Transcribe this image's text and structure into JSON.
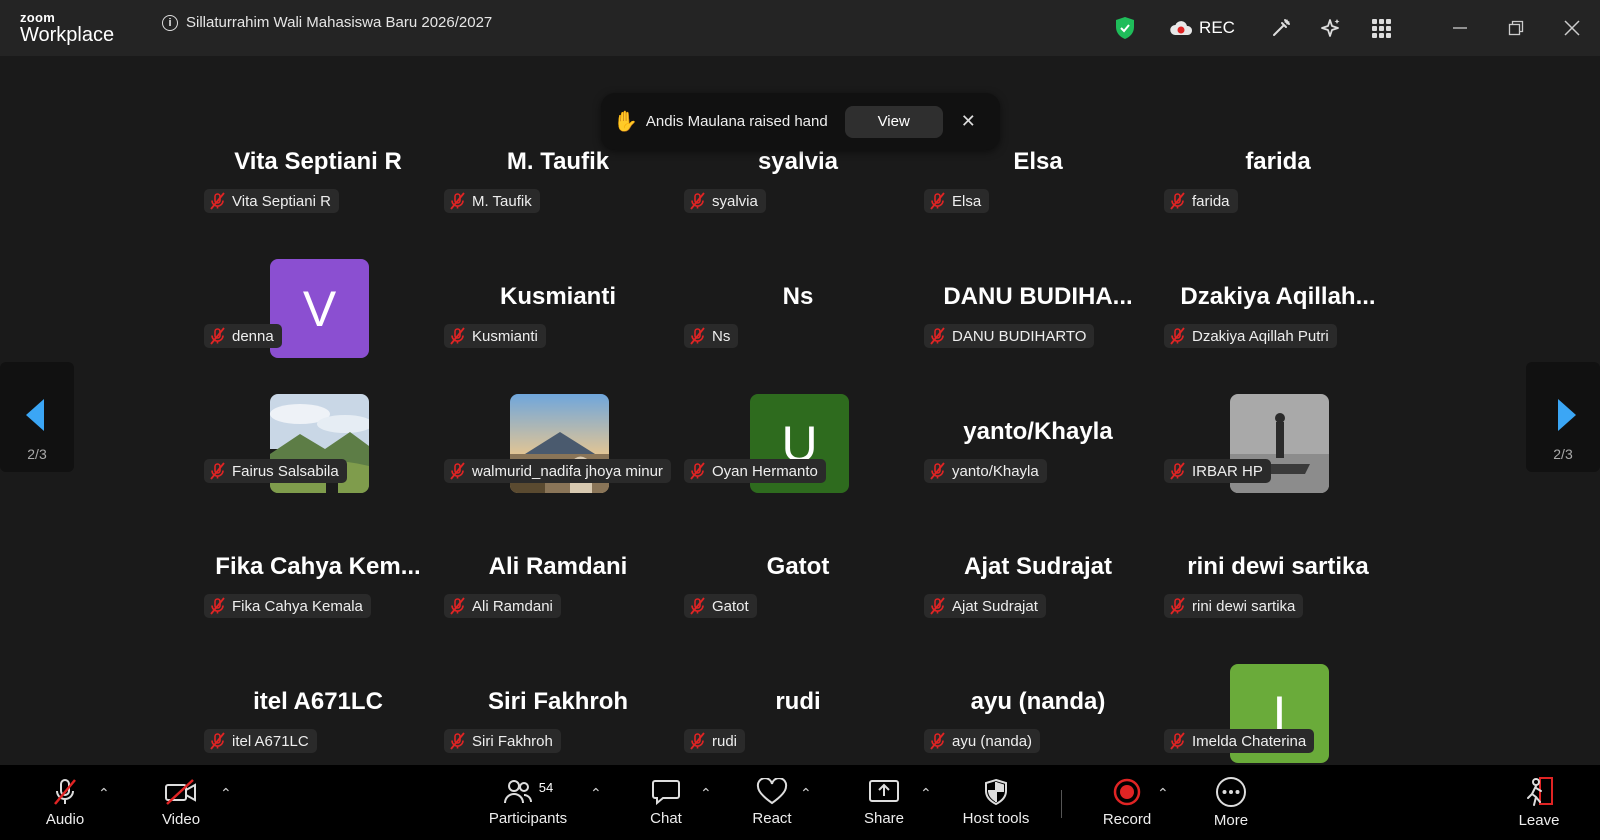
{
  "app": {
    "logo_top": "zoom",
    "logo_bottom": "Workplace",
    "meeting_title": "Sillaturrahim Wali Mahasiswa Baru 2026/2027"
  },
  "titlebar": {
    "rec_label": "REC"
  },
  "toast": {
    "message": "Andis Maulana raised hand",
    "view_label": "View",
    "close": "✕"
  },
  "pager": {
    "left_page": "2/3",
    "right_page": "2/3"
  },
  "participants": [
    {
      "big": "Vita Septiani R",
      "pill": "Vita Septiani R"
    },
    {
      "big": "M. Taufik",
      "pill": "M. Taufik"
    },
    {
      "big": "syalvia",
      "pill": "syalvia"
    },
    {
      "big": "Elsa",
      "pill": "Elsa"
    },
    {
      "big": "farida",
      "pill": "farida"
    },
    {
      "big": "",
      "pill": "denna",
      "avatar": "V",
      "avatar_color": "#8b4fd1"
    },
    {
      "big": "Kusmianti",
      "pill": "Kusmianti"
    },
    {
      "big": "Ns",
      "pill": "Ns"
    },
    {
      "big": "DANU  BUDIHA...",
      "pill": "DANU BUDIHARTO"
    },
    {
      "big": "Dzakiya  Aqillah...",
      "pill": "Dzakiya Aqillah Putri"
    },
    {
      "big": "",
      "pill": "Fairus Salsabila",
      "photo": "hills"
    },
    {
      "big": "",
      "pill": "walmurid_nadifa jhoya minur",
      "photo": "mountain"
    },
    {
      "big": "",
      "pill": "Oyan Hermanto",
      "avatar": "U",
      "avatar_color": "#2e6b1e"
    },
    {
      "big": "yanto/Khayla",
      "pill": "yanto/Khayla"
    },
    {
      "big": "",
      "pill": "IRBAR HP",
      "photo": "statue"
    },
    {
      "big": "Fika  Cahya  Kem...",
      "pill": "Fika Cahya Kemala"
    },
    {
      "big": "Ali Ramdani",
      "pill": "Ali Ramdani"
    },
    {
      "big": "Gatot",
      "pill": "Gatot"
    },
    {
      "big": "Ajat  Sudrajat",
      "pill": "Ajat  Sudrajat"
    },
    {
      "big": "rini dewi sartika",
      "pill": "rini dewi sartika"
    },
    {
      "big": "itel A671LC",
      "pill": "itel A671LC"
    },
    {
      "big": "Siri Fakhroh",
      "pill": "Siri Fakhroh"
    },
    {
      "big": "rudi",
      "pill": "rudi"
    },
    {
      "big": "ayu (nanda)",
      "pill": "ayu (nanda)"
    },
    {
      "big": "",
      "pill": "Imelda Chaterina",
      "avatar": "I",
      "avatar_color": "#6aab3a"
    }
  ],
  "toolbar": {
    "audio": "Audio",
    "video": "Video",
    "participants": "Participants",
    "participant_count": "54",
    "chat": "Chat",
    "react": "React",
    "share": "Share",
    "host_tools": "Host tools",
    "record": "Record",
    "more": "More",
    "leave": "Leave"
  },
  "colors": {
    "shield": "#1fbd5a",
    "record": "#e02424",
    "pager_arrow": "#3ba6f5"
  }
}
